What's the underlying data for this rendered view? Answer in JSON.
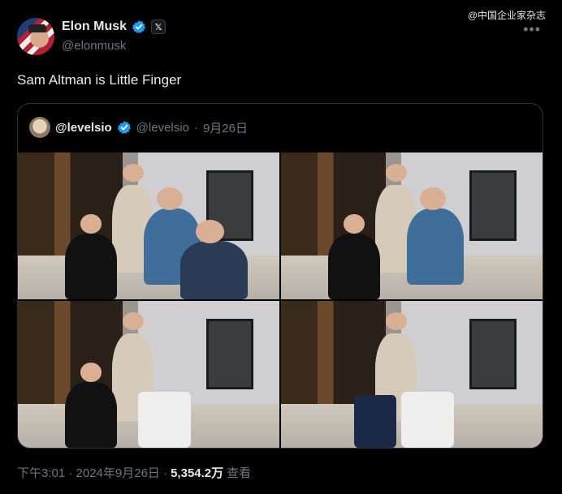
{
  "watermark": "@中国企业家杂志",
  "author": {
    "display_name": "Elon Musk",
    "handle": "@elonmusk",
    "x_badge": "𝕏"
  },
  "more_menu": "•••",
  "tweet": {
    "text": "Sam Altman is Little Finger"
  },
  "quoted": {
    "display_name": "@levelsio",
    "handle": "@levelsio",
    "separator": "·",
    "date": "9月26日"
  },
  "footer": {
    "time": "下午3:01 · 2024年9月26日 ·",
    "views_count": "5,354.2万",
    "views_label": "查看"
  },
  "colors": {
    "background": "#000000",
    "text_primary": "#e7e9ea",
    "text_secondary": "#71767b",
    "verified_blue": "#1d9bf0",
    "border": "#2f3336"
  }
}
